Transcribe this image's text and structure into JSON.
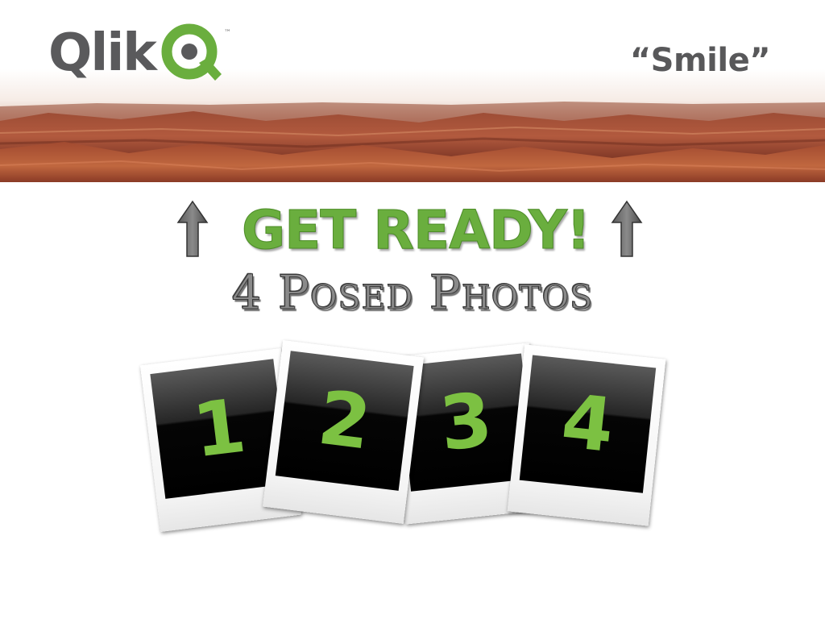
{
  "header": {
    "logo_text": "Qlik",
    "logo_tm": "™",
    "slogan": "“Smile”",
    "brand_green": "#6aae3e",
    "brand_grey": "#5a5a5c"
  },
  "headline": {
    "title": "GET READY!",
    "subtitle": "4 Posed Photos",
    "arrow_icon": "up-arrow-icon"
  },
  "photos": {
    "items": [
      {
        "label": "1"
      },
      {
        "label": "2"
      },
      {
        "label": "3"
      },
      {
        "label": "4"
      }
    ],
    "number_color": "#7cc142"
  }
}
